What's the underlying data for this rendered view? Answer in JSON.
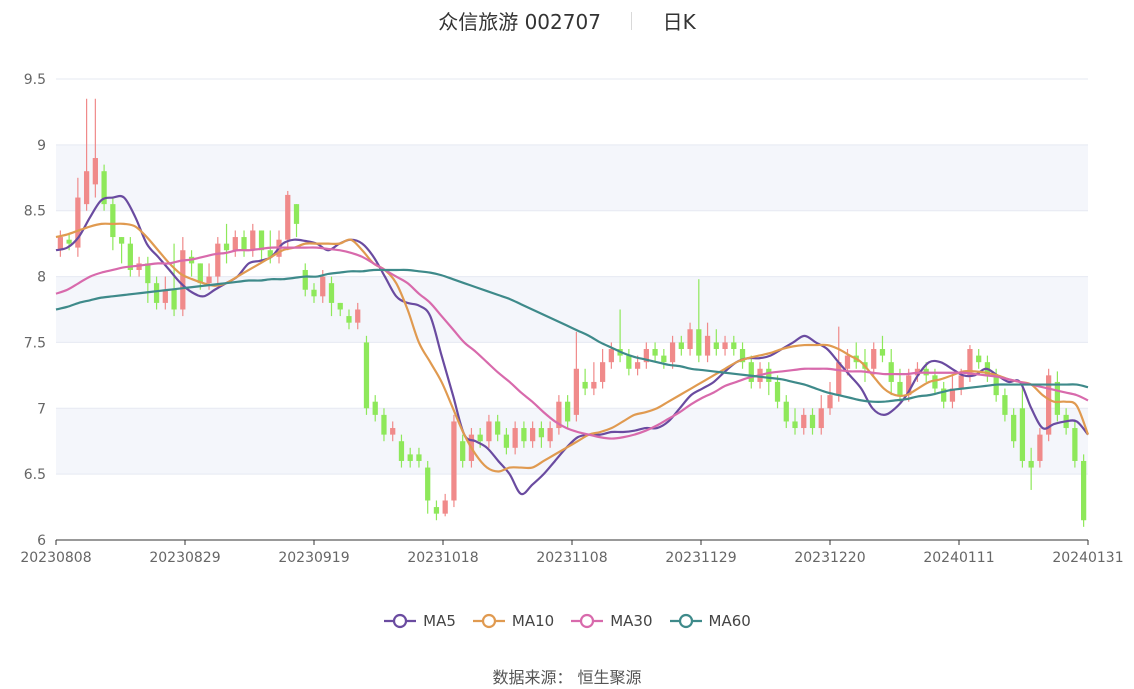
{
  "title": {
    "text": "众信旅游 002707",
    "period": "日K"
  },
  "source": {
    "label": "数据来源：",
    "value": "恒生聚源"
  },
  "colors": {
    "up": "#f08a8a",
    "down": "#8ee85a",
    "band": "#f4f6fb",
    "grid": "#e6e9f2",
    "axis": "#333333"
  },
  "chart_data": {
    "type": "candlestick",
    "ylim": [
      6,
      9.5
    ],
    "y_ticks": [
      "6",
      "6.5",
      "7",
      "7.5",
      "8",
      "8.5",
      "9",
      "9.5"
    ],
    "x_ticks": [
      "20230808",
      "20230829",
      "20230919",
      "20231018",
      "20231108",
      "20231129",
      "20231220",
      "20240111",
      "20240131"
    ],
    "series": [
      {
        "name": "MA5",
        "color": "#6a4ba0",
        "values": [
          8.2,
          8.22,
          8.3,
          8.45,
          8.58,
          8.6,
          8.6,
          8.45,
          8.25,
          8.15,
          8.05,
          7.95,
          7.88,
          7.85,
          7.9,
          7.95,
          8.0,
          8.1,
          8.12,
          8.15,
          8.25,
          8.28,
          8.27,
          8.25,
          8.2,
          8.25,
          8.28,
          8.25,
          8.15,
          8.0,
          7.85,
          7.8,
          7.78,
          7.7,
          7.4,
          7.1,
          6.8,
          6.75,
          6.7,
          6.6,
          6.5,
          6.35,
          6.42,
          6.5,
          6.6,
          6.7,
          6.78,
          6.8,
          6.8,
          6.82,
          6.82,
          6.83,
          6.85,
          6.85,
          6.9,
          7.0,
          7.1,
          7.15,
          7.2,
          7.28,
          7.35,
          7.38,
          7.38,
          7.4,
          7.45,
          7.5,
          7.55,
          7.5,
          7.45,
          7.35,
          7.25,
          7.15,
          7.0,
          6.95,
          7.0,
          7.1,
          7.25,
          7.35,
          7.35,
          7.3,
          7.25,
          7.25,
          7.3,
          7.25,
          7.2,
          7.2,
          7.0,
          6.85,
          6.88,
          6.9,
          6.9,
          6.8
        ]
      },
      {
        "name": "MA10",
        "color": "#e09a50",
        "values": [
          8.3,
          8.32,
          8.35,
          8.38,
          8.4,
          8.4,
          8.4,
          8.38,
          8.3,
          8.2,
          8.1,
          8.02,
          7.98,
          7.95,
          7.93,
          7.95,
          8.0,
          8.05,
          8.1,
          8.15,
          8.2,
          8.22,
          8.25,
          8.25,
          8.25,
          8.25,
          8.28,
          8.2,
          8.1,
          8.05,
          7.95,
          7.75,
          7.5,
          7.35,
          7.2,
          7.0,
          6.8,
          6.65,
          6.55,
          6.52,
          6.55,
          6.55,
          6.55,
          6.6,
          6.65,
          6.7,
          6.75,
          6.8,
          6.82,
          6.85,
          6.9,
          6.95,
          6.97,
          7.0,
          7.05,
          7.1,
          7.15,
          7.2,
          7.25,
          7.3,
          7.35,
          7.38,
          7.4,
          7.42,
          7.45,
          7.47,
          7.48,
          7.48,
          7.48,
          7.45,
          7.4,
          7.35,
          7.25,
          7.15,
          7.1,
          7.1,
          7.15,
          7.2,
          7.22,
          7.25,
          7.28,
          7.28,
          7.27,
          7.25,
          7.22,
          7.2,
          7.18,
          7.1,
          7.05,
          7.05,
          7.02,
          6.8
        ]
      },
      {
        "name": "MA30",
        "color": "#d86aac",
        "values": [
          7.87,
          7.9,
          7.95,
          8.0,
          8.03,
          8.05,
          8.07,
          8.08,
          8.09,
          8.1,
          8.1,
          8.12,
          8.13,
          8.15,
          8.17,
          8.18,
          8.2,
          8.2,
          8.21,
          8.22,
          8.22,
          8.22,
          8.22,
          8.22,
          8.21,
          8.2,
          8.18,
          8.15,
          8.1,
          8.05,
          8.0,
          7.95,
          7.87,
          7.8,
          7.7,
          7.6,
          7.5,
          7.43,
          7.35,
          7.27,
          7.2,
          7.12,
          7.05,
          6.97,
          6.9,
          6.85,
          6.82,
          6.8,
          6.78,
          6.77,
          6.78,
          6.8,
          6.83,
          6.87,
          6.92,
          6.97,
          7.03,
          7.08,
          7.12,
          7.17,
          7.2,
          7.23,
          7.25,
          7.27,
          7.28,
          7.29,
          7.3,
          7.3,
          7.3,
          7.29,
          7.28,
          7.28,
          7.27,
          7.26,
          7.26,
          7.26,
          7.27,
          7.27,
          7.27,
          7.27,
          7.27,
          7.26,
          7.25,
          7.24,
          7.22,
          7.2,
          7.18,
          7.16,
          7.14,
          7.12,
          7.1,
          7.06
        ]
      },
      {
        "name": "MA60",
        "color": "#3e8a8a",
        "values": [
          7.75,
          7.77,
          7.8,
          7.82,
          7.84,
          7.85,
          7.86,
          7.87,
          7.88,
          7.89,
          7.9,
          7.91,
          7.92,
          7.93,
          7.94,
          7.95,
          7.96,
          7.97,
          7.97,
          7.98,
          7.98,
          7.99,
          8.0,
          8.0,
          8.02,
          8.03,
          8.04,
          8.04,
          8.05,
          8.05,
          8.05,
          8.05,
          8.04,
          8.03,
          8.01,
          7.98,
          7.95,
          7.92,
          7.89,
          7.86,
          7.83,
          7.79,
          7.75,
          7.71,
          7.67,
          7.63,
          7.59,
          7.55,
          7.5,
          7.46,
          7.42,
          7.39,
          7.37,
          7.35,
          7.33,
          7.32,
          7.3,
          7.29,
          7.28,
          7.27,
          7.26,
          7.25,
          7.24,
          7.23,
          7.22,
          7.2,
          7.18,
          7.15,
          7.12,
          7.1,
          7.08,
          7.06,
          7.05,
          7.05,
          7.06,
          7.07,
          7.09,
          7.1,
          7.12,
          7.14,
          7.15,
          7.16,
          7.17,
          7.18,
          7.18,
          7.18,
          7.18,
          7.18,
          7.18,
          7.18,
          7.18,
          7.16
        ]
      }
    ],
    "candles": [
      [
        8.2,
        8.3,
        8.15,
        8.35
      ],
      [
        8.28,
        8.25,
        8.2,
        8.32
      ],
      [
        8.22,
        8.6,
        8.15,
        8.75
      ],
      [
        8.55,
        8.8,
        8.5,
        9.35
      ],
      [
        8.7,
        8.9,
        8.6,
        9.35
      ],
      [
        8.8,
        8.55,
        8.5,
        8.85
      ],
      [
        8.55,
        8.3,
        8.2,
        8.6
      ],
      [
        8.3,
        8.25,
        8.1,
        8.3
      ],
      [
        8.25,
        8.05,
        8.0,
        8.3
      ],
      [
        8.05,
        8.1,
        8.0,
        8.15
      ],
      [
        8.1,
        7.95,
        7.8,
        8.15
      ],
      [
        7.95,
        7.8,
        7.75,
        8.0
      ],
      [
        7.8,
        7.9,
        7.75,
        8.0
      ],
      [
        7.9,
        7.75,
        7.7,
        8.25
      ],
      [
        7.75,
        8.2,
        7.7,
        8.3
      ],
      [
        8.15,
        8.1,
        8.0,
        8.2
      ],
      [
        8.1,
        7.95,
        7.9,
        8.1
      ],
      [
        7.95,
        8.0,
        7.9,
        8.1
      ],
      [
        8.0,
        8.25,
        7.95,
        8.3
      ],
      [
        8.25,
        8.2,
        8.1,
        8.4
      ],
      [
        8.2,
        8.3,
        8.15,
        8.35
      ],
      [
        8.3,
        8.2,
        8.15,
        8.35
      ],
      [
        8.2,
        8.35,
        8.15,
        8.4
      ],
      [
        8.35,
        8.2,
        8.1,
        8.35
      ],
      [
        8.2,
        8.15,
        8.1,
        8.35
      ],
      [
        8.15,
        8.28,
        8.1,
        8.35
      ],
      [
        8.28,
        8.62,
        8.2,
        8.65
      ],
      [
        8.55,
        8.4,
        8.3,
        8.55
      ],
      [
        8.05,
        7.9,
        7.85,
        8.1
      ],
      [
        7.9,
        7.85,
        7.8,
        7.95
      ],
      [
        7.85,
        8.0,
        7.8,
        8.05
      ],
      [
        7.95,
        7.8,
        7.7,
        8.0
      ],
      [
        7.8,
        7.75,
        7.7,
        7.8
      ],
      [
        7.7,
        7.65,
        7.6,
        7.75
      ],
      [
        7.65,
        7.75,
        7.6,
        7.8
      ],
      [
        7.5,
        7.0,
        6.95,
        7.55
      ],
      [
        7.05,
        6.95,
        6.9,
        7.1
      ],
      [
        6.95,
        6.8,
        6.75,
        7.0
      ],
      [
        6.8,
        6.85,
        6.75,
        6.9
      ],
      [
        6.75,
        6.6,
        6.55,
        6.8
      ],
      [
        6.65,
        6.6,
        6.55,
        6.7
      ],
      [
        6.65,
        6.6,
        6.55,
        6.7
      ],
      [
        6.55,
        6.3,
        6.2,
        6.6
      ],
      [
        6.25,
        6.2,
        6.15,
        6.3
      ],
      [
        6.2,
        6.3,
        6.18,
        6.35
      ],
      [
        6.3,
        6.9,
        6.25,
        6.95
      ],
      [
        6.75,
        6.6,
        6.55,
        6.8
      ],
      [
        6.6,
        6.8,
        6.55,
        6.85
      ],
      [
        6.8,
        6.75,
        6.7,
        6.85
      ],
      [
        6.75,
        6.9,
        6.7,
        6.95
      ],
      [
        6.9,
        6.8,
        6.75,
        6.95
      ],
      [
        6.8,
        6.7,
        6.65,
        6.85
      ],
      [
        6.7,
        6.85,
        6.65,
        6.9
      ],
      [
        6.85,
        6.75,
        6.7,
        6.9
      ],
      [
        6.75,
        6.85,
        6.7,
        6.9
      ],
      [
        6.85,
        6.78,
        6.7,
        6.9
      ],
      [
        6.75,
        6.85,
        6.7,
        6.9
      ],
      [
        6.85,
        7.05,
        6.8,
        7.1
      ],
      [
        7.05,
        6.9,
        6.85,
        7.1
      ],
      [
        6.95,
        7.3,
        6.9,
        7.58
      ],
      [
        7.2,
        7.15,
        7.1,
        7.3
      ],
      [
        7.15,
        7.2,
        7.1,
        7.35
      ],
      [
        7.2,
        7.35,
        7.15,
        7.45
      ],
      [
        7.35,
        7.45,
        7.3,
        7.5
      ],
      [
        7.45,
        7.4,
        7.35,
        7.75
      ],
      [
        7.4,
        7.3,
        7.25,
        7.45
      ],
      [
        7.3,
        7.35,
        7.25,
        7.4
      ],
      [
        7.35,
        7.45,
        7.3,
        7.5
      ],
      [
        7.45,
        7.4,
        7.35,
        7.5
      ],
      [
        7.4,
        7.35,
        7.3,
        7.45
      ],
      [
        7.35,
        7.5,
        7.3,
        7.55
      ],
      [
        7.5,
        7.45,
        7.4,
        7.55
      ],
      [
        7.45,
        7.6,
        7.4,
        7.65
      ],
      [
        7.6,
        7.4,
        7.35,
        7.98
      ],
      [
        7.4,
        7.55,
        7.35,
        7.65
      ],
      [
        7.5,
        7.45,
        7.4,
        7.6
      ],
      [
        7.45,
        7.5,
        7.4,
        7.55
      ],
      [
        7.5,
        7.45,
        7.4,
        7.55
      ],
      [
        7.45,
        7.35,
        7.3,
        7.5
      ],
      [
        7.35,
        7.2,
        7.15,
        7.4
      ],
      [
        7.2,
        7.3,
        7.15,
        7.35
      ],
      [
        7.3,
        7.2,
        7.1,
        7.35
      ],
      [
        7.2,
        7.05,
        7.0,
        7.25
      ],
      [
        7.05,
        6.9,
        6.85,
        7.1
      ],
      [
        6.9,
        6.85,
        6.8,
        7.0
      ],
      [
        6.85,
        6.95,
        6.8,
        7.0
      ],
      [
        6.95,
        6.85,
        6.8,
        7.0
      ],
      [
        6.85,
        7.0,
        6.8,
        7.1
      ],
      [
        7.0,
        7.1,
        6.95,
        7.2
      ],
      [
        7.1,
        7.35,
        7.05,
        7.62
      ],
      [
        7.3,
        7.4,
        7.25,
        7.45
      ],
      [
        7.4,
        7.35,
        7.3,
        7.5
      ],
      [
        7.35,
        7.3,
        7.2,
        7.45
      ],
      [
        7.3,
        7.45,
        7.25,
        7.5
      ],
      [
        7.45,
        7.4,
        7.35,
        7.55
      ],
      [
        7.35,
        7.2,
        7.1,
        7.45
      ],
      [
        7.2,
        7.1,
        7.05,
        7.3
      ],
      [
        7.1,
        7.25,
        7.05,
        7.3
      ],
      [
        7.25,
        7.3,
        7.2,
        7.35
      ],
      [
        7.3,
        7.25,
        7.2,
        7.35
      ],
      [
        7.25,
        7.15,
        7.1,
        7.3
      ],
      [
        7.15,
        7.05,
        7.0,
        7.2
      ],
      [
        7.05,
        7.15,
        7.0,
        7.25
      ],
      [
        7.15,
        7.25,
        7.1,
        7.3
      ],
      [
        7.25,
        7.45,
        7.2,
        7.48
      ],
      [
        7.4,
        7.35,
        7.3,
        7.45
      ],
      [
        7.35,
        7.25,
        7.2,
        7.4
      ],
      [
        7.25,
        7.1,
        7.05,
        7.3
      ],
      [
        7.1,
        6.95,
        6.9,
        7.15
      ],
      [
        6.95,
        6.75,
        6.7,
        7.0
      ],
      [
        7.0,
        6.6,
        6.55,
        7.2
      ],
      [
        6.6,
        6.55,
        6.38,
        6.7
      ],
      [
        6.6,
        6.8,
        6.55,
        6.85
      ],
      [
        6.8,
        7.25,
        6.75,
        7.3
      ],
      [
        7.2,
        6.95,
        6.9,
        7.28
      ],
      [
        6.95,
        6.85,
        6.8,
        7.0
      ],
      [
        6.85,
        6.6,
        6.55,
        6.9
      ],
      [
        6.6,
        6.15,
        6.1,
        6.65
      ]
    ]
  }
}
